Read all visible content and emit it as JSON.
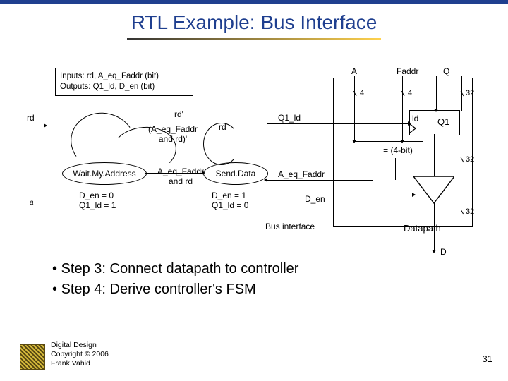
{
  "title": "RTL Example: Bus Interface",
  "fsm": {
    "inputs": "Inputs: rd, A_eq_Faddr (bit)",
    "outputs": "Outputs: Q1_ld, D_en (bit)"
  },
  "signals": {
    "rd": "rd",
    "rd_prime": "rd'",
    "aeq_and_rd_prime": "(A_eq_Faddr and rd)'",
    "aeq_and_rd": "A_eq_Faddr and rd",
    "rd_loop": "rd",
    "Q1_ld": "Q1_ld",
    "A_eq_Faddr": "A_eq_Faddr",
    "D_en": "D_en",
    "bus_interface": "Bus interface"
  },
  "states": {
    "s1": "Wait.My.Address",
    "s2": "Send.Data",
    "s1_actions_l1": "D_en = 0",
    "s1_actions_l2": "Q1_ld = 1",
    "s2_actions_l1": "D_en = 1",
    "s2_actions_l2": "Q1_ld = 0"
  },
  "datapath": {
    "A": "A",
    "Faddr": "Faddr",
    "Q": "Q",
    "ld": "ld",
    "Q1": "Q1",
    "cmp": "= (4-bit)",
    "label": "Datapath",
    "D": "D",
    "w4a": "4",
    "w4b": "4",
    "w32a": "32",
    "w32b": "32",
    "w32c": "32"
  },
  "bullets": {
    "b1": "Step 3: Connect datapath to controller",
    "b2": "Step 4: Derive controller's FSM"
  },
  "footer": {
    "l1": "Digital Design",
    "l2": "Copyright © 2006",
    "l3": "Frank Vahid"
  },
  "page": "31",
  "alpha": "a"
}
